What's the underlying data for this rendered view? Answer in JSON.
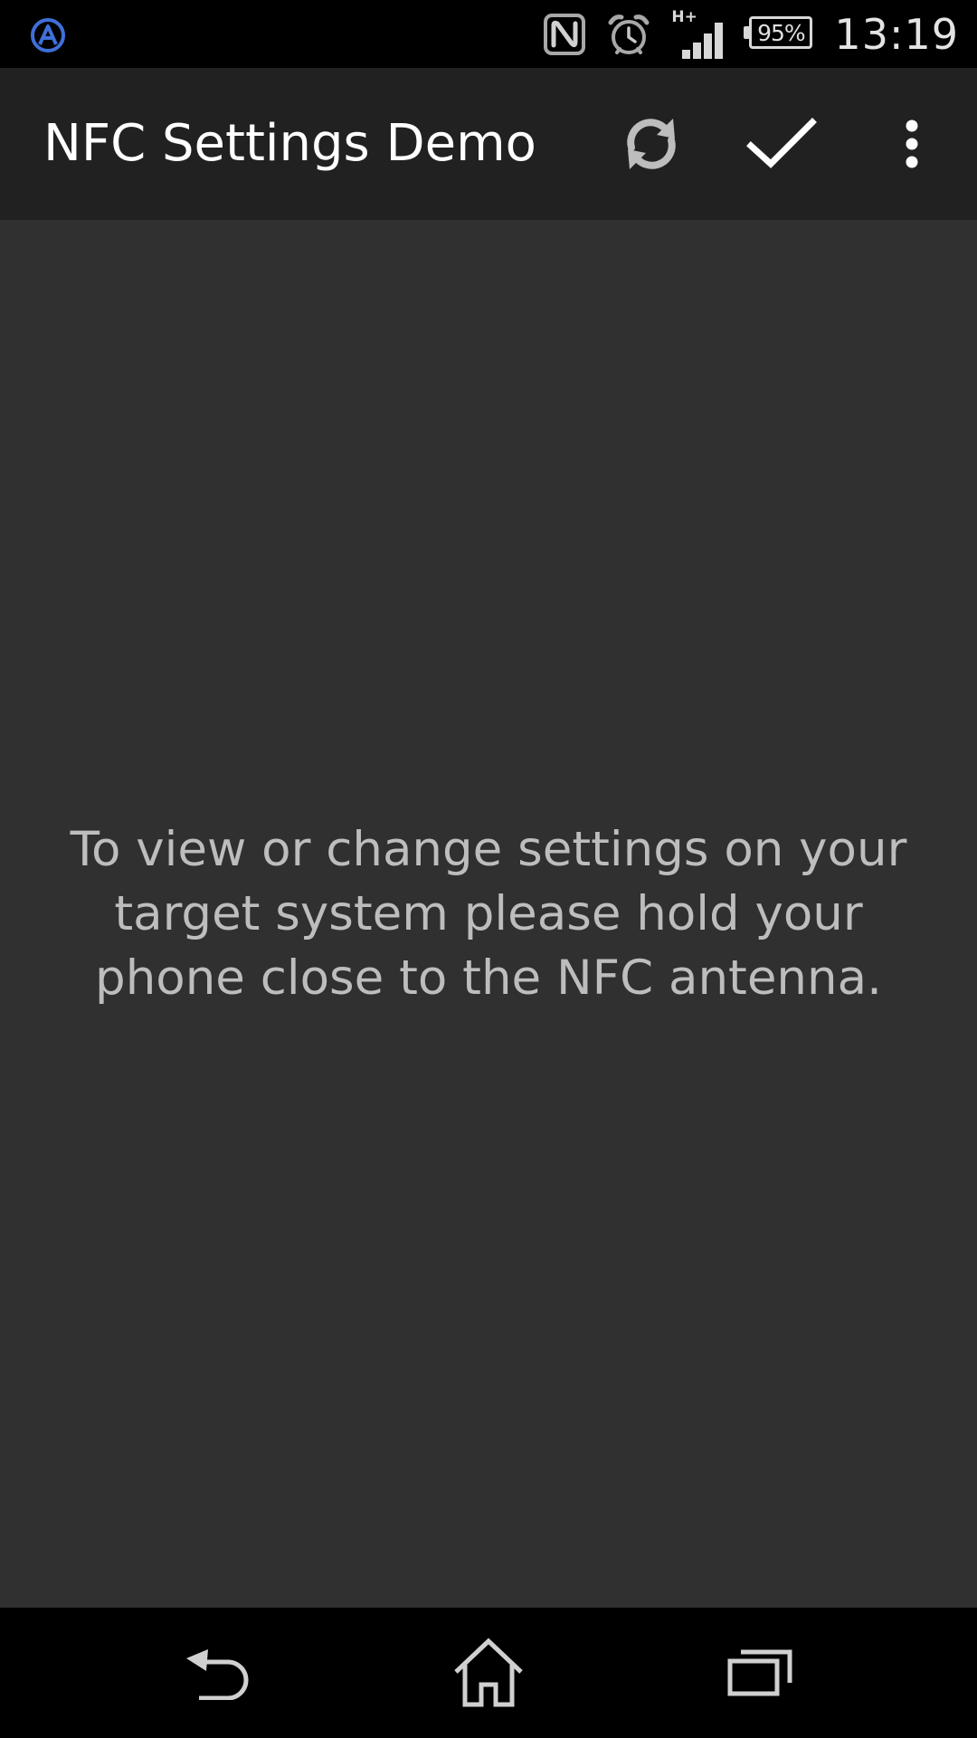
{
  "status_bar": {
    "notification_icon": "app-circle-a-icon",
    "icons": [
      "nfc-icon",
      "alarm-clock-icon",
      "signal-strength-icon",
      "battery-icon"
    ],
    "network_type": "H+",
    "battery_percent": "95%",
    "time": "13:19",
    "colors": {
      "background": "#000000",
      "notification_accent": "#3f6fd8",
      "icon": "#d8d8d8"
    }
  },
  "action_bar": {
    "title": "NFC Settings Demo",
    "actions": [
      {
        "icon": "refresh-icon"
      },
      {
        "icon": "checkmark-icon"
      },
      {
        "icon": "overflow-menu-icon"
      }
    ],
    "colors": {
      "background": "#212121",
      "title": "#ffffff",
      "refresh_icon": "#bdbdbd"
    }
  },
  "main": {
    "message": "To view or change settings on your target system please hold your phone close to the NFC antenna.",
    "colors": {
      "background": "#303030",
      "message": "#bdbdbd"
    }
  },
  "nav_bar": {
    "buttons": [
      {
        "icon": "back-icon"
      },
      {
        "icon": "home-icon"
      },
      {
        "icon": "recent-apps-icon"
      }
    ],
    "colors": {
      "background": "#000000",
      "icon": "#d0d0d0"
    }
  }
}
